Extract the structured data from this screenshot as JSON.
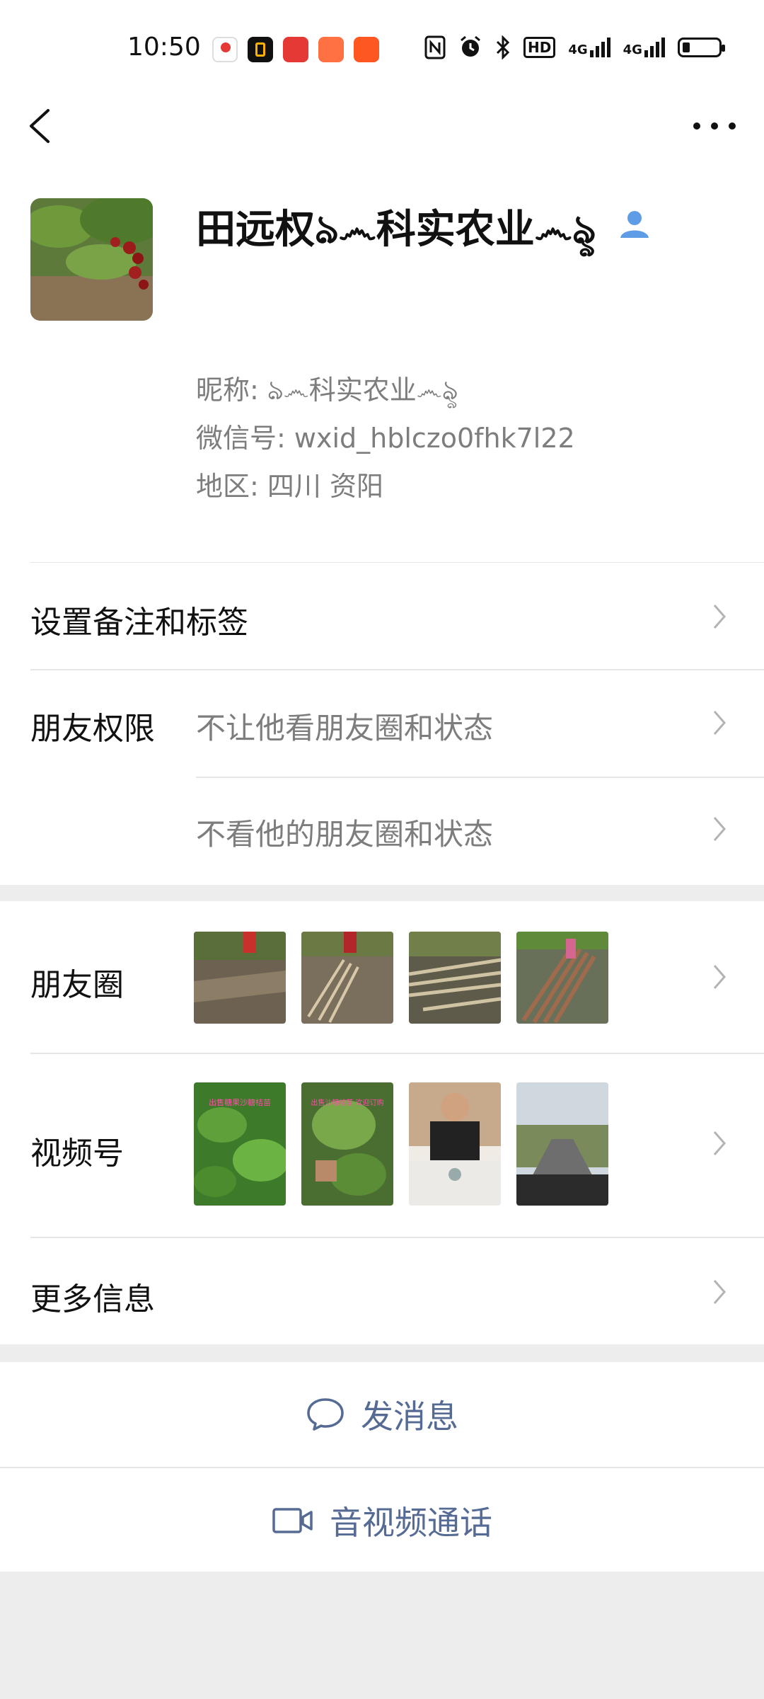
{
  "status_bar": {
    "time": "10:50",
    "icons": [
      "location-app-icon",
      "app-icon-1",
      "app-icon-2",
      "app-icon-3",
      "app-icon-4",
      "nfc-icon",
      "alarm-icon",
      "bluetooth-icon",
      "hd-icon",
      "signal-4g-icon",
      "signal-4g-icon-2",
      "battery-icon"
    ],
    "hd_label": "HD",
    "net1": "4G",
    "net2": "4G"
  },
  "nav": {
    "back_icon": "back-arrow-icon",
    "more_icon": "more-dots-icon"
  },
  "profile": {
    "name": "田远权ঌ෴科实农业෴ৡ",
    "nickname": "昵称: ঌ෴科实农业෴ৡ",
    "wechat_id": "微信号: wxid_hblczo0fhk7l22",
    "region": "地区: 四川 资阳"
  },
  "rows": {
    "remark": "设置备注和标签",
    "permission_label": "朋友权限",
    "permission_1": "不让他看朋友圈和状态",
    "permission_2": "不看他的朋友圈和状态",
    "moments": "朋友圈",
    "channels": "视频号",
    "more_info": "更多信息"
  },
  "thumb_captions": {
    "channel_1": "出售糖果沙糖桔苗",
    "channel_2": "出售沙糖桔苗 欢迎订购"
  },
  "actions": {
    "message": "发消息",
    "call": "音视频通话"
  },
  "colors": {
    "accent": "#566b94",
    "secondary_text": "#7d7d7d",
    "background": "#ededed"
  }
}
